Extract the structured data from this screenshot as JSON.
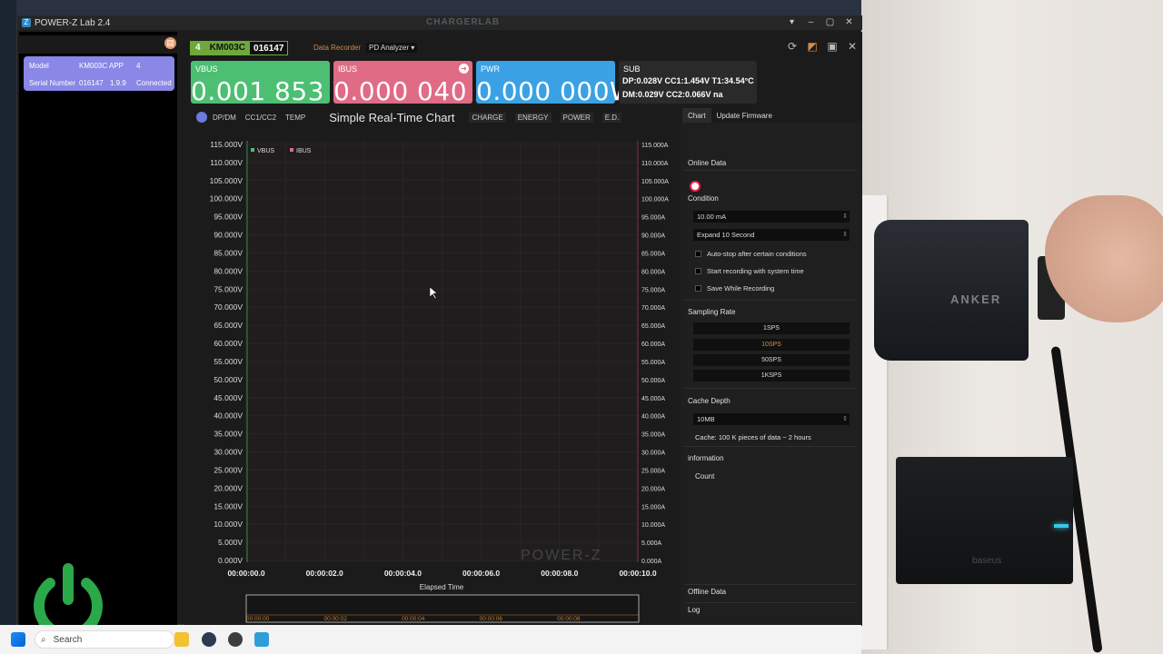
{
  "window": {
    "title": "POWER-Z Lab 2.4",
    "brand": "CHARGERLAB"
  },
  "sidebar": {
    "device": {
      "model_label": "Model",
      "model_value": "KM003C",
      "app_label": "APP",
      "app_value": "4",
      "serial_label": "Serial Number",
      "serial_value": "016147",
      "version": "1.9.9",
      "status": "Connected"
    }
  },
  "header": {
    "device_num": "4",
    "model": "KM003C",
    "serial": "016147",
    "tab_recorder": "Data Recorder",
    "tab_pd": "PD Analyzer"
  },
  "cards": {
    "vbus": {
      "label": "VBUS",
      "value": "0.001 853 V",
      "color": "#4cbf73"
    },
    "ibus": {
      "label": "IBUS",
      "value": "0.000 040 A",
      "color": "#e06b85"
    },
    "pwr": {
      "label": "PWR",
      "value": "0.000 000W",
      "color": "#3aa2e4"
    },
    "sub": {
      "label": "SUB",
      "line1": "DP:0.028V  CC1:1.454V  T1:34.54°C",
      "line2": "DM:0.029V  CC2:0.066V na"
    }
  },
  "chart_toolbar": {
    "tabs_left": [
      "DP/DM",
      "CC1/CC2",
      "TEMP"
    ],
    "title": "Simple Real-Time Chart",
    "tabs_right": [
      "CHARGE",
      "ENERGY",
      "POWER",
      "E.D."
    ]
  },
  "chart_data": {
    "type": "line",
    "title": "Simple Real-Time Chart",
    "xlabel": "Elapsed Time",
    "x_ticks": [
      "00:00:00.0",
      "00:00:02.0",
      "00:00:04.0",
      "00:00:06.0",
      "00:00:08.0",
      "00:00:10.0"
    ],
    "y_left_ticks": [
      "115.000V",
      "110.000V",
      "105.000V",
      "100.000V",
      "95.000V",
      "90.000V",
      "85.000V",
      "80.000V",
      "75.000V",
      "70.000V",
      "65.000V",
      "60.000V",
      "55.000V",
      "50.000V",
      "45.000V",
      "40.000V",
      "35.000V",
      "30.000V",
      "25.000V",
      "20.000V",
      "15.000V",
      "10.000V",
      "5.000V",
      "0.000V"
    ],
    "y_right_ticks": [
      "115.000A",
      "110.000A",
      "105.000A",
      "100.000A",
      "95.000A",
      "90.000A",
      "85.000A",
      "80.000A",
      "75.000A",
      "70.000A",
      "65.000A",
      "60.000A",
      "55.000A",
      "50.000A",
      "45.000A",
      "40.000A",
      "35.000A",
      "30.000A",
      "25.000A",
      "20.000A",
      "15.000A",
      "10.000A",
      "5.000A",
      "0.000A"
    ],
    "ylim": [
      0,
      115
    ],
    "series": [
      {
        "name": "VBUS",
        "color": "#4cbf73",
        "values": []
      },
      {
        "name": "IBUS",
        "color": "#e06b85",
        "values": []
      }
    ],
    "legend": "top-left",
    "watermark": "POWER-Z",
    "overview_ticks": [
      "00:00:00",
      "00:00:02",
      "00:00:04",
      "00:00:06",
      "00:00:08"
    ]
  },
  "panel": {
    "tab_chart": "Chart",
    "tab_firmware": "Update Firmware",
    "online_data": "Online Data",
    "condition": "Condition",
    "condition_value": "10.00 mA",
    "expand_value": "Expand 10 Second",
    "checks": [
      "Auto-stop after certain conditions",
      "Start recording with system time",
      "Save While Recording"
    ],
    "sampling_rate": "Sampling Rate",
    "rates": [
      "1SPS",
      "10SPS",
      "50SPS",
      "1KSPS"
    ],
    "selected_rate": "10SPS",
    "cache_depth": "Cache Depth",
    "cache_value": "10MB",
    "cache_info": "Cache: 100 K pieces of data  ~ 2 hours",
    "information": "information",
    "count": "Count",
    "offline_data": "Offline Data",
    "log": "Log"
  },
  "taskbar": {
    "search_placeholder": "Search"
  },
  "photo": {
    "anker_label": "ANKER",
    "baseus_label": "baseus"
  }
}
